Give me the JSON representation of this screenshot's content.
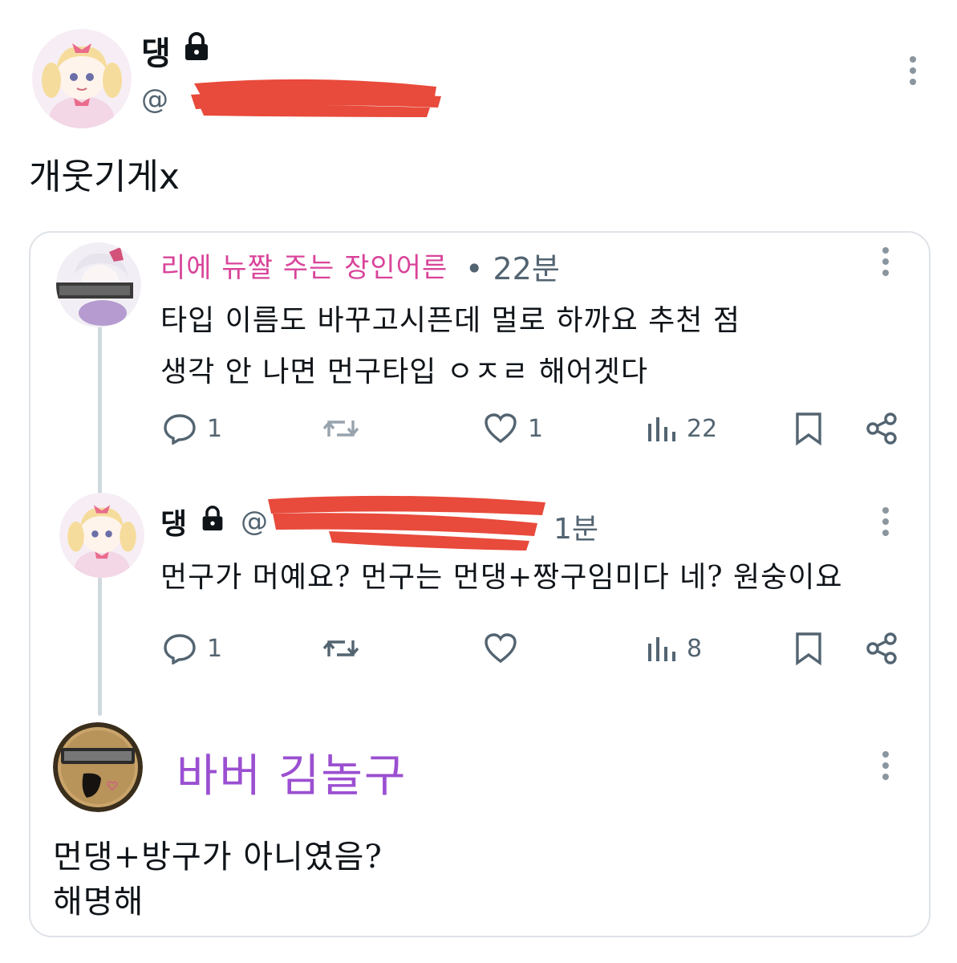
{
  "post": {
    "author_name": "댕",
    "handle_prefix": "@",
    "text": "개웃기게x"
  },
  "replies": [
    {
      "author_name": "리에 뉴짤 주는 장인어른",
      "time": "• 22분",
      "text_line1": "타입 이름도 바꾸고시픈데 멀로 하까요 추천 점",
      "text_line2": "생각 안 나면 먼구타입 ㅇㅈㄹ 해어겟다",
      "stats": {
        "replies": "1",
        "reposts": "",
        "likes": "1",
        "views": "22"
      }
    },
    {
      "author_name": "댕",
      "handle_prefix": "@",
      "time": "1분",
      "text": "먼구가 머예요? 먼구는 먼댕+짱구임미다 네? 원숭이요",
      "stats": {
        "replies": "1",
        "reposts": "",
        "likes": "",
        "views": "8"
      }
    },
    {
      "author_name": "바버 김놀구",
      "text_line1": "먼댕+방구가 아니였음?",
      "text_line2": "해명해"
    }
  ],
  "icons": {
    "more": "more-vertical-icon",
    "lock": "lock-icon",
    "reply": "reply-icon",
    "repost": "repost-icon",
    "like": "heart-icon",
    "views": "views-chart-icon",
    "bookmark": "bookmark-icon",
    "share": "share-icon"
  },
  "colors": {
    "redaction": "#e84a3b",
    "reply_name_pink": "#d9449a",
    "reply_name_purple": "#9b4fd1",
    "muted": "#536471"
  }
}
